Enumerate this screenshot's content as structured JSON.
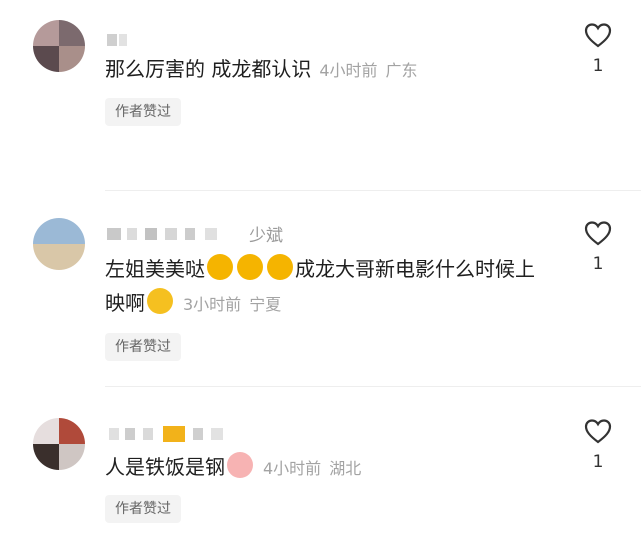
{
  "comments": [
    {
      "username_tail": "",
      "text": "那么厉害的 成龙都认识",
      "time": "4小时前",
      "location": "广东",
      "author_tag": "作者赞过",
      "likes": "1"
    },
    {
      "username_tail": "少斌",
      "text_before": "左姐美美哒",
      "text_mid": "成龙大哥新电影什么时候上映啊",
      "emoji_love": "love-eyes-emoji",
      "emoji_cry": "crying-emoji",
      "time": "3小时前",
      "location": "宁夏",
      "author_tag": "作者赞过",
      "likes": "1"
    },
    {
      "username_tail": "",
      "text": "人是铁饭是钢",
      "emoji_pig": "pig-emoji",
      "time": "4小时前",
      "location": "湖北",
      "author_tag": "作者赞过",
      "likes": "1"
    }
  ],
  "colors": {
    "text": "#1f1f1f",
    "meta": "#a3a3a3",
    "tag_bg": "#f3f3f3",
    "emoji": "#f5b400",
    "heart_outline": "#333333"
  }
}
